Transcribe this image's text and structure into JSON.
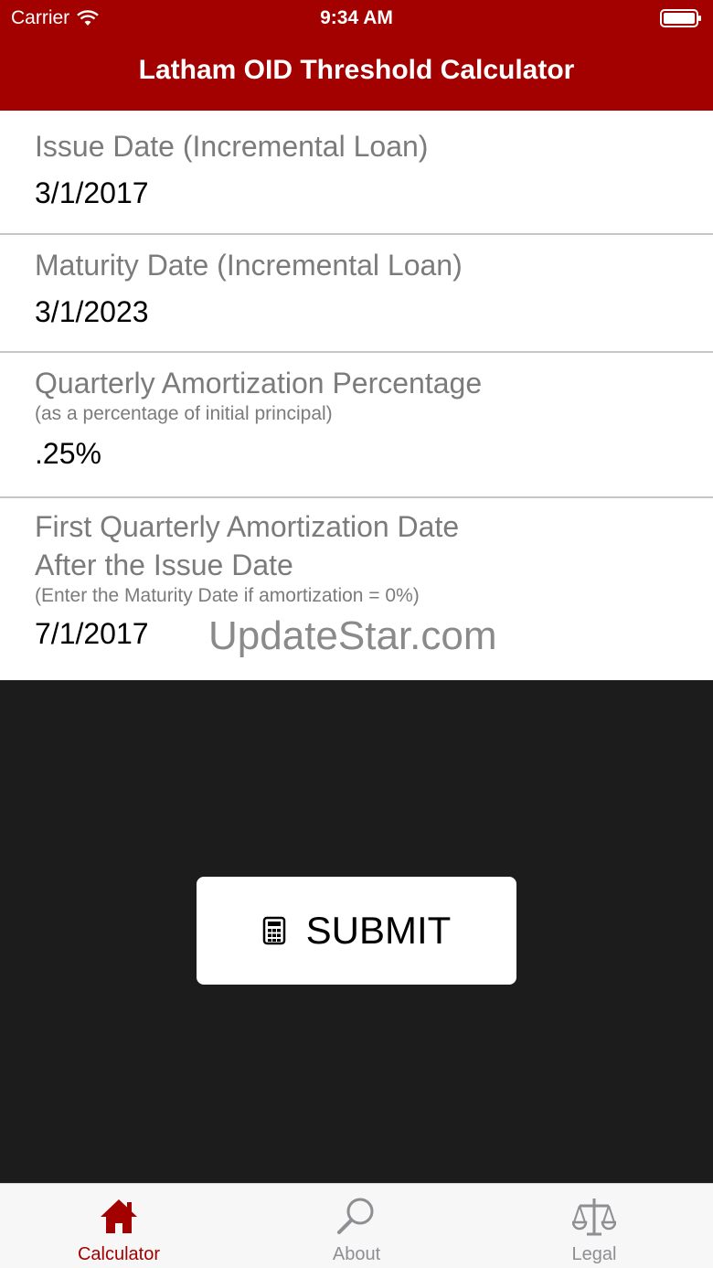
{
  "status_bar": {
    "carrier": "Carrier",
    "time": "9:34 AM"
  },
  "header": {
    "title": "Latham OID Threshold Calculator"
  },
  "form": {
    "issue_date": {
      "label": "Issue Date (Incremental Loan)",
      "value": "3/1/2017"
    },
    "maturity_date": {
      "label": "Maturity Date (Incremental Loan)",
      "value": "3/1/2023"
    },
    "amortization_percentage": {
      "label": "Quarterly Amortization Percentage",
      "hint": "(as a percentage of initial principal)",
      "value": ".25%"
    },
    "first_amortization_date": {
      "label_line1": "First Quarterly Amortization Date",
      "label_line2": "After the Issue Date",
      "hint": "(Enter the Maturity Date if amortization = 0%)",
      "value": "7/1/2017"
    }
  },
  "watermark": "UpdateStar.com",
  "submit": {
    "label": "SUBMIT",
    "icon": "calculator-icon"
  },
  "tabs": [
    {
      "label": "Calculator",
      "icon": "house-icon",
      "active": true
    },
    {
      "label": "About",
      "icon": "magnifier-icon",
      "active": false
    },
    {
      "label": "Legal",
      "icon": "scales-icon",
      "active": false
    }
  ],
  "colors": {
    "brand": "#a30000",
    "background": "#1c1c1c",
    "tab_inactive": "#8e8e93"
  }
}
